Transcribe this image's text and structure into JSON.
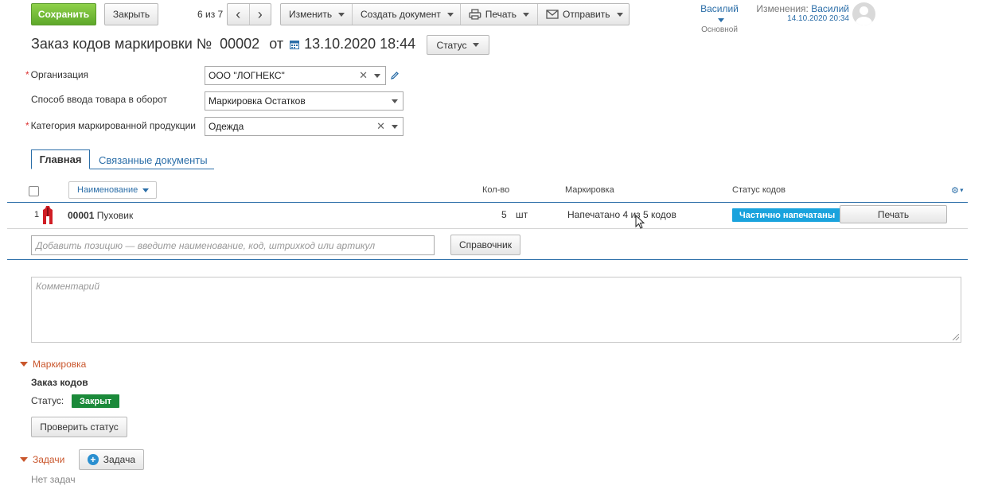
{
  "toolbar": {
    "save": "Сохранить",
    "close": "Закрыть",
    "pager": "6 из 7",
    "edit": "Изменить",
    "create_doc": "Создать документ",
    "print": "Печать",
    "send": "Отправить"
  },
  "user": {
    "name": "Василий",
    "role": "Основной",
    "changes_label": "Изменения:",
    "changes_user": "Василий",
    "changes_time": "14.10.2020 20:34"
  },
  "header": {
    "title": "Заказ кодов маркировки №",
    "number": "00002",
    "from": "от",
    "date": "13.10.2020 18:44",
    "status_btn": "Статус"
  },
  "form": {
    "organization_label": "Организация",
    "organization_value": "ООО \"ЛОГНЕКС\"",
    "input_method_label": "Способ ввода товара в оборот",
    "input_method_value": "Маркировка Остатков",
    "category_label": "Категория маркированной продукции",
    "category_value": "Одежда"
  },
  "tabs": {
    "main": "Главная",
    "related": "Связанные документы"
  },
  "table": {
    "col_name": "Наименование",
    "col_qty": "Кол-во",
    "col_marking": "Маркировка",
    "col_status": "Статус кодов",
    "rows": [
      {
        "index": "1",
        "code": "00001",
        "name": "Пуховик",
        "qty": "5",
        "unit": "шт",
        "marking": "Напечатано 4 из 5 кодов",
        "status": "Частично напечатаны",
        "print_btn": "Печать"
      }
    ],
    "add_placeholder": "Добавить позицию — введите наименование, код, штрихкод или артикул",
    "catalog_btn": "Справочник"
  },
  "comment_placeholder": "Комментарий",
  "marking_section": {
    "title": "Маркировка",
    "subtitle": "Заказ кодов",
    "status_label": "Статус:",
    "status_value": "Закрыт",
    "check_btn": "Проверить статус"
  },
  "tasks_section": {
    "title": "Задачи",
    "add_btn": "Задача",
    "empty": "Нет задач"
  },
  "colors": {
    "accent": "#2b6ea8",
    "save_green": "#6bb52f",
    "badge_blue": "#1aa3dd",
    "badge_green": "#1b8a3a",
    "section_orange": "#c9562c"
  }
}
